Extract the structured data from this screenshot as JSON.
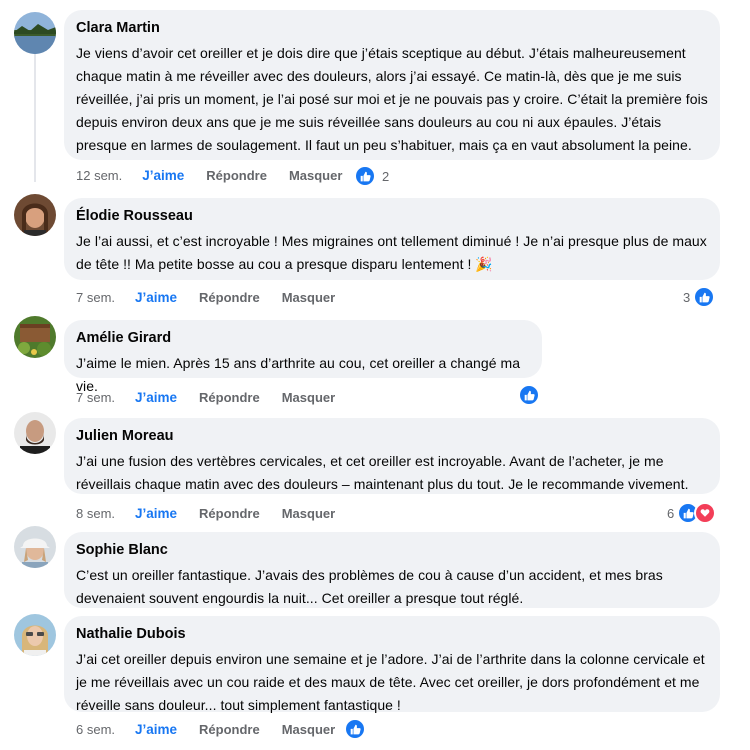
{
  "labels": {
    "like": "J’aime",
    "reply": "Répondre",
    "hide": "Masquer"
  },
  "colors": {
    "accent": "#1877f2",
    "heart": "#f33e58",
    "bubble": "#f0f2f5"
  },
  "comments": [
    {
      "author": "Clara Martin",
      "text": "Je viens d’avoir cet oreiller et je dois dire que j’étais sceptique au début.  J’étais malheureusement chaque matin à  me réveiller avec des douleurs, alors j’ai essayé. Ce matin-là, dès que je me suis réveillée, j’ai pris un moment, je l’ai posé sur moi et je ne pouvais pas y croire. C’était la première fois depuis environ deux ans que je me suis réveillée sans douleurs au cou ni aux épaules. J’étais presque en larmes de soulagement. Il faut un peu s’habituer, mais ça en vaut absolument la peine.",
      "time": "12 sem.",
      "reactions": "2",
      "avatar_icon": "landscape-avatar"
    },
    {
      "author": "Élodie Rousseau",
      "text": "Je l’ai aussi, et c’est incroyable ! Mes migraines ont tellement diminué ! Je n’ai presque plus de maux de tête !! Ma petite bosse au cou a presque disparu lentement ! 🎉",
      "time": "7 sem.",
      "reactions": "3",
      "avatar_icon": "woman-avatar"
    },
    {
      "author": "Amélie Girard",
      "text": "J’aime le mien. Après 15 ans d’arthrite au cou, cet oreiller a changé ma vie.",
      "time": "7 sem.",
      "reactions": "",
      "avatar_icon": "garden-avatar"
    },
    {
      "author": "Julien Moreau",
      "text": "J’ai une fusion des vertèbres cervicales, et cet oreiller est incroyable. Avant de l’acheter, je me réveillais chaque matin avec des douleurs – maintenant plus du tout. Je le recommande vivement.",
      "time": "8 sem.",
      "reactions": "6",
      "avatar_icon": "man-avatar"
    },
    {
      "author": "Sophie Blanc",
      "text": "C’est un oreiller fantastique. J’avais des problèmes de cou à cause d’un accident, et mes bras devenaient souvent engourdis la nuit... Cet oreiller a presque tout réglé.",
      "avatar_icon": "woman-cap-avatar"
    },
    {
      "author": "Nathalie Dubois",
      "text": "J’ai cet oreiller depuis environ une semaine et je l’adore. J’ai de l’arthrite dans la colonne cervicale et je me réveillais avec un cou raide et des maux de tête. Avec cet oreiller, je dors profondément et me réveille sans douleur... tout simplement fantastique !",
      "time": "6 sem.",
      "reactions": "",
      "avatar_icon": "woman-blonde-avatar"
    }
  ]
}
